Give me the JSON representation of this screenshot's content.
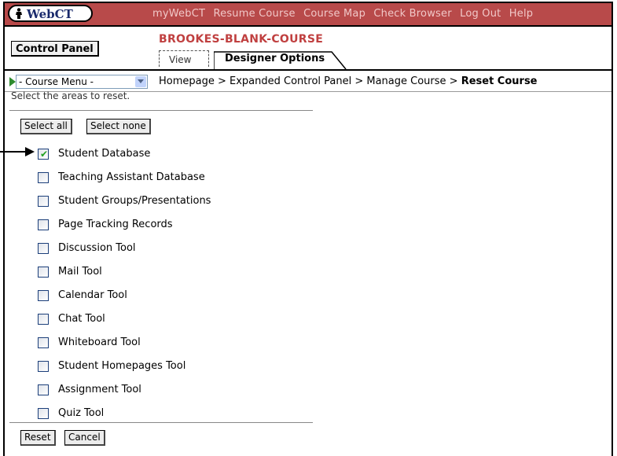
{
  "header": {
    "logo_text": "WebCT",
    "nav": [
      "myWebCT",
      "Resume Course",
      "Course Map",
      "Check Browser",
      "Log Out",
      "Help"
    ]
  },
  "control_panel_label": "Control Panel",
  "course_title": "BROOKES-BLANK-COURSE",
  "tabs": {
    "view": "View",
    "designer": "Designer Options"
  },
  "course_menu": {
    "selected": "- Course Menu -"
  },
  "breadcrumb": {
    "path": "Homepage > Expanded Control Panel > Manage Course > ",
    "current": "Reset Course"
  },
  "instructions": "Select the areas to reset.",
  "buttons": {
    "select_all": "Select all",
    "select_none": "Select none",
    "reset": "Reset",
    "cancel": "Cancel"
  },
  "areas": [
    {
      "label": "Student Database",
      "checked": true
    },
    {
      "label": "Teaching Assistant Database",
      "checked": false
    },
    {
      "label": "Student Groups/Presentations",
      "checked": false
    },
    {
      "label": "Page Tracking Records",
      "checked": false
    },
    {
      "label": "Discussion Tool",
      "checked": false
    },
    {
      "label": "Mail Tool",
      "checked": false
    },
    {
      "label": "Calendar Tool",
      "checked": false
    },
    {
      "label": "Chat Tool",
      "checked": false
    },
    {
      "label": "Whiteboard Tool",
      "checked": false
    },
    {
      "label": "Student Homepages Tool",
      "checked": false
    },
    {
      "label": "Assignment Tool",
      "checked": false
    },
    {
      "label": "Quiz Tool",
      "checked": false
    }
  ],
  "colors": {
    "header_bg": "#b84a4a",
    "nav_text": "#f1c8c8",
    "course_title": "#c04040"
  }
}
